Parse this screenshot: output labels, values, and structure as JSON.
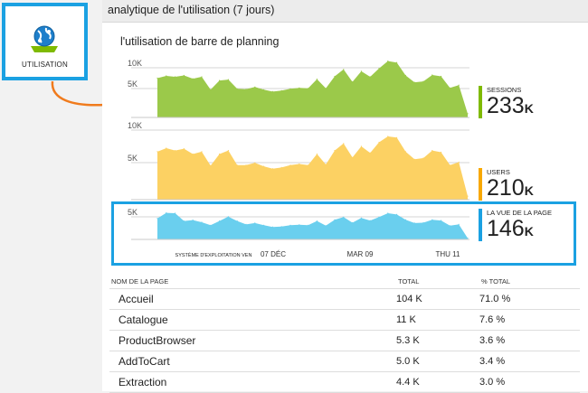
{
  "tile": {
    "label": "UTILISATION",
    "icon": "usage-globe-icon"
  },
  "blade": {
    "title": "analytique de l'utilisation (7 jours)"
  },
  "chart_title": "l'utilisation de barre de planning",
  "metrics": [
    {
      "label": "SESSIONS",
      "value": "233",
      "unit": "K",
      "color": "#7fba00"
    },
    {
      "label": "USERS",
      "value": "210",
      "unit": "K",
      "color": "#f8a800"
    },
    {
      "label": "LA VUE DE LA PAGE",
      "value": "146",
      "unit": "K",
      "color": "#1ba1e2"
    }
  ],
  "chart_data": [
    {
      "type": "area",
      "series": [
        {
          "name": "SESSIONS",
          "values": [
            8.5,
            9.0,
            8.8,
            9.1,
            8.4,
            8.8,
            6.0,
            8.0,
            8.2,
            6.2,
            6.1,
            6.6,
            6.0,
            5.6,
            5.8,
            6.2,
            6.4,
            6.3,
            8.3,
            6.3,
            8.9,
            10.4,
            7.7,
            10.0,
            8.8,
            10.6,
            12.2,
            11.9,
            9.1,
            7.6,
            7.8,
            9.2,
            8.9,
            6.4,
            7.0,
            0.8
          ]
        }
      ],
      "color": "#9bc94a",
      "yticks": [
        "10K",
        "5K"
      ],
      "ylim": [
        0,
        13.3
      ]
    },
    {
      "type": "area",
      "series": [
        {
          "name": "USERS",
          "values": [
            8.2,
            8.8,
            8.4,
            8.7,
            7.8,
            8.2,
            5.8,
            7.8,
            8.4,
            5.9,
            5.9,
            6.3,
            5.7,
            5.3,
            5.5,
            5.9,
            6.1,
            5.9,
            7.8,
            6.0,
            8.4,
            9.6,
            7.2,
            9.1,
            8.0,
            9.8,
            10.8,
            10.6,
            8.2,
            6.9,
            7.1,
            8.4,
            8.1,
            5.9,
            6.4,
            0.6
          ]
        }
      ],
      "color": "#fcd163",
      "yticks": [
        "10K",
        "5K"
      ],
      "ylim": [
        0,
        12.5
      ]
    },
    {
      "type": "area",
      "series": [
        {
          "name": "LA VUE DE LA PAGE",
          "values": [
            4.9,
            6.2,
            6.1,
            4.3,
            4.5,
            4.0,
            3.3,
            4.3,
            5.3,
            4.3,
            3.5,
            3.8,
            3.3,
            2.9,
            3.0,
            3.3,
            3.4,
            3.3,
            4.3,
            3.2,
            4.6,
            5.2,
            3.9,
            5.0,
            4.4,
            5.2,
            6.1,
            5.8,
            4.6,
            3.8,
            3.9,
            4.6,
            4.4,
            3.2,
            3.5,
            0.3
          ]
        }
      ],
      "color": "#6acfee",
      "yticks": [
        "5K"
      ],
      "ylim": [
        0,
        8
      ],
      "xticks": [
        "SYSTÈME D'EXPLOITATION VEN",
        "07 DÉC",
        "MAR 09",
        "THU 11"
      ]
    }
  ],
  "table": {
    "columns": [
      "NOM DE LA PAGE",
      "TOTAL",
      "% TOTAL"
    ],
    "rows": [
      {
        "name": "Accueil",
        "total": "104 K",
        "pct": "71.0 %"
      },
      {
        "name": "Catalogue",
        "total": "11 K",
        "pct": "7.6 %"
      },
      {
        "name": "ProductBrowser",
        "total": "5.3 K",
        "pct": "3.6 %"
      },
      {
        "name": "AddToCart",
        "total": "5.0 K",
        "pct": "3.4 %"
      },
      {
        "name": "Extraction",
        "total": "4.4 K",
        "pct": "3.0 %"
      }
    ]
  }
}
